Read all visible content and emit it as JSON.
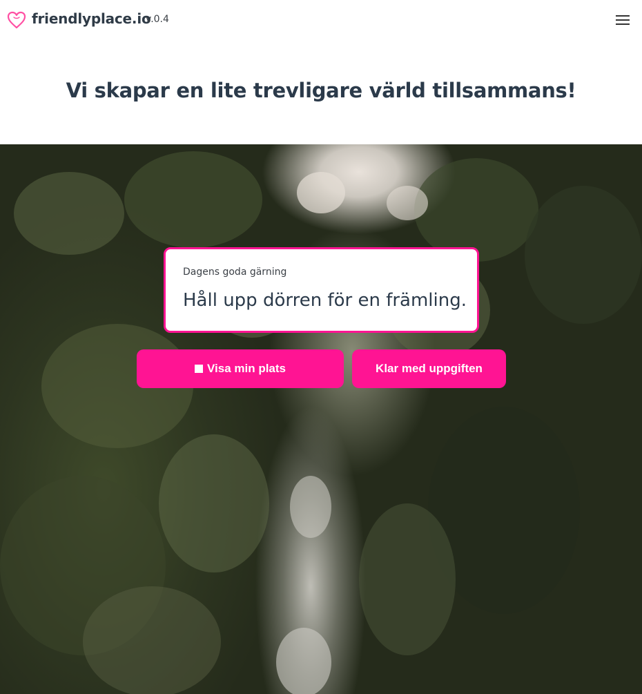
{
  "header": {
    "brand_name": "friendlyplace.io",
    "version": "v.0.4",
    "logo_icon": "heart-outline-icon",
    "menu_icon": "hamburger-menu-icon"
  },
  "headline": "Vi skapar en lite trevligare värld tillsammans!",
  "deed": {
    "label": "Dagens goda gärning",
    "text": "Håll upp dörren för en främling."
  },
  "actions": {
    "show_location_label": "Visa min plats",
    "show_location_icon": "stop-square-icon",
    "done_label": "Klar med uppgiften"
  },
  "colors": {
    "accent": "#ff1493",
    "text_dark": "#2b3a4a"
  }
}
